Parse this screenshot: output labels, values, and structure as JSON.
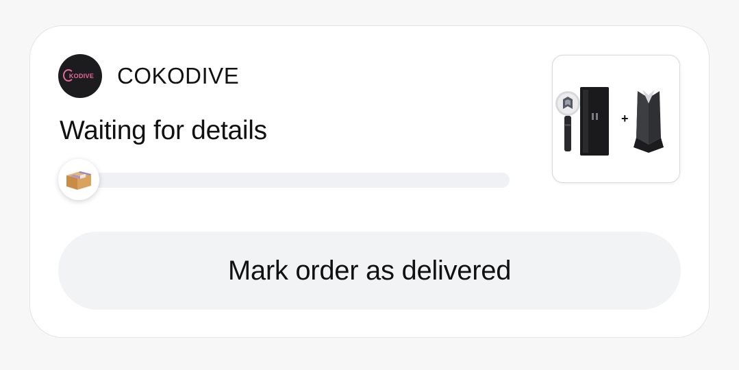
{
  "order": {
    "seller": {
      "name": "COKODIVE",
      "logo_text": "KODIVE",
      "logo_icon": "cokodive-logo-icon"
    },
    "status": "Waiting for details",
    "progress": {
      "fraction": 0,
      "knob_icon": "package-box-icon"
    },
    "product_image": {
      "icon": "lightstick-product-image",
      "plus": "+"
    },
    "action_button": {
      "label": "Mark order as delivered"
    }
  },
  "colors": {
    "background": "#f7f7f8",
    "card": "#ffffff",
    "button_bg": "#f2f3f5",
    "track": "#f0f1f4",
    "logo_bg": "#1c1c1e",
    "logo_accent": "#e86a9a",
    "text": "#111111"
  }
}
